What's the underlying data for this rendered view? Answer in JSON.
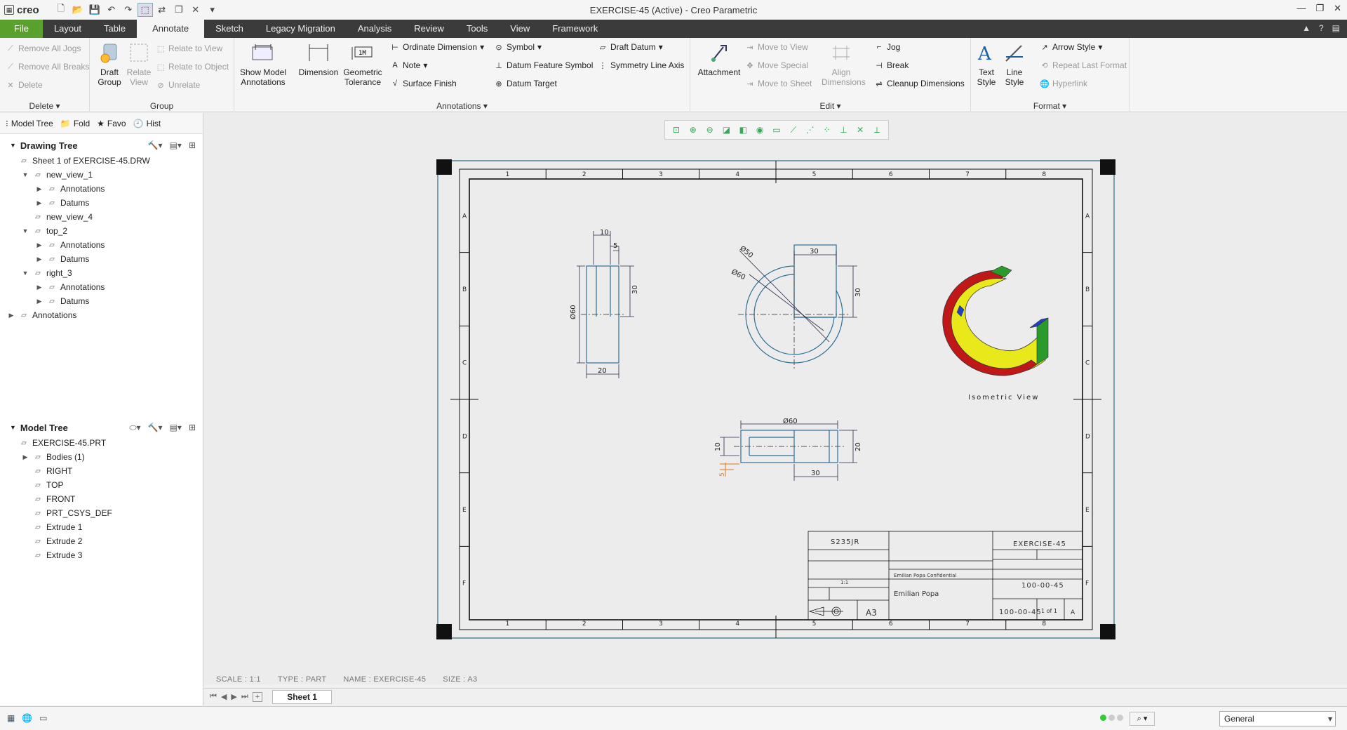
{
  "titlebar": {
    "logo": "creo",
    "title": "EXERCISE-45 (Active) - Creo Parametric"
  },
  "tabs": [
    "File",
    "Layout",
    "Table",
    "Annotate",
    "Sketch",
    "Legacy Migration",
    "Analysis",
    "Review",
    "Tools",
    "View",
    "Framework"
  ],
  "active_tab": "Annotate",
  "ribbon": {
    "delete": {
      "items": [
        "Remove All Jogs",
        "Remove All Breaks",
        "Delete"
      ],
      "label": "Delete"
    },
    "group": {
      "draft_group": "Draft Group",
      "relate_view": "Relate View",
      "items": [
        "Relate to View",
        "Relate to Object",
        "Unrelate"
      ],
      "label": "Group"
    },
    "annotations": {
      "show_model": "Show Model Annotations",
      "dimension": "Dimension",
      "geometric_tolerance": "Geometric Tolerance",
      "col1": [
        "Ordinate Dimension",
        "Note",
        "Surface Finish"
      ],
      "col2": [
        "Symbol",
        "Datum Feature Symbol",
        "Datum Target"
      ],
      "col3": [
        "Draft Datum",
        "Symmetry Line Axis"
      ],
      "label": "Annotations"
    },
    "edit": {
      "attachment": "Attachment",
      "moves": [
        "Move to View",
        "Move Special",
        "Move to Sheet"
      ],
      "align": "Align Dimensions",
      "col3": [
        "Jog",
        "Break",
        "Cleanup Dimensions"
      ],
      "label": "Edit"
    },
    "format": {
      "text_style": "Text Style",
      "line_style": "Line Style",
      "items": [
        "Arrow Style",
        "Repeat Last Format",
        "Hyperlink"
      ],
      "label": "Format"
    }
  },
  "navtabs": [
    "Model Tree",
    "Fold",
    "Favo",
    "Hist"
  ],
  "drawing_tree": {
    "header": "Drawing Tree",
    "rows": [
      {
        "label": "Sheet 1 of EXERCISE-45.DRW",
        "depth": 0,
        "expand": ""
      },
      {
        "label": "new_view_1",
        "depth": 1,
        "expand": "▼"
      },
      {
        "label": "Annotations",
        "depth": 2,
        "expand": "▶"
      },
      {
        "label": "Datums",
        "depth": 2,
        "expand": "▶"
      },
      {
        "label": "new_view_4",
        "depth": 1,
        "expand": ""
      },
      {
        "label": "top_2",
        "depth": 1,
        "expand": "▼"
      },
      {
        "label": "Annotations",
        "depth": 2,
        "expand": "▶"
      },
      {
        "label": "Datums",
        "depth": 2,
        "expand": "▶"
      },
      {
        "label": "right_3",
        "depth": 1,
        "expand": "▼"
      },
      {
        "label": "Annotations",
        "depth": 2,
        "expand": "▶"
      },
      {
        "label": "Datums",
        "depth": 2,
        "expand": "▶"
      },
      {
        "label": "Annotations",
        "depth": 0,
        "expand": "▶"
      }
    ]
  },
  "model_tree": {
    "header": "Model Tree",
    "rows": [
      {
        "label": "EXERCISE-45.PRT",
        "depth": 0,
        "expand": ""
      },
      {
        "label": "Bodies (1)",
        "depth": 1,
        "expand": "▶"
      },
      {
        "label": "RIGHT",
        "depth": 1,
        "expand": ""
      },
      {
        "label": "TOP",
        "depth": 1,
        "expand": ""
      },
      {
        "label": "FRONT",
        "depth": 1,
        "expand": ""
      },
      {
        "label": "PRT_CSYS_DEF",
        "depth": 1,
        "expand": ""
      },
      {
        "label": "Extrude 1",
        "depth": 1,
        "expand": ""
      },
      {
        "label": "Extrude 2",
        "depth": 1,
        "expand": ""
      },
      {
        "label": "Extrude 3",
        "depth": 1,
        "expand": ""
      }
    ]
  },
  "drawing": {
    "col_zones": [
      "1",
      "2",
      "3",
      "4",
      "5",
      "6",
      "7",
      "8"
    ],
    "row_zones": [
      "A",
      "B",
      "C",
      "D",
      "E",
      "F"
    ],
    "dims": {
      "front_top": "10",
      "front_small": "5",
      "front_height": "30",
      "front_dia": "Ø60",
      "front_bottom": "20",
      "top_d50": "Ø50",
      "top_d60": "Ø60",
      "top_w": "30",
      "top_h": "30",
      "bot_dia": "Ø60",
      "bot_left": "10",
      "bot_small": "5",
      "bot_right": "20",
      "bot_bottom": "30"
    },
    "iso_label": "Isometric View",
    "titleblock": {
      "material": "S235JR",
      "name": "Emilian Popa",
      "sheet_size": "A3",
      "scale": "1:1",
      "description": "EXERCISE-45",
      "part_number": "100-00-45",
      "drawing_number": "100-00-45",
      "sheet": "1 of 1",
      "revision": "A",
      "confidential": "Emilian Popa Confidential"
    }
  },
  "status_info": [
    "SCALE : 1:1",
    "TYPE : PART",
    "NAME : EXERCISE-45",
    "SIZE : A3"
  ],
  "sheet_tab": "Sheet 1",
  "filter": "General"
}
